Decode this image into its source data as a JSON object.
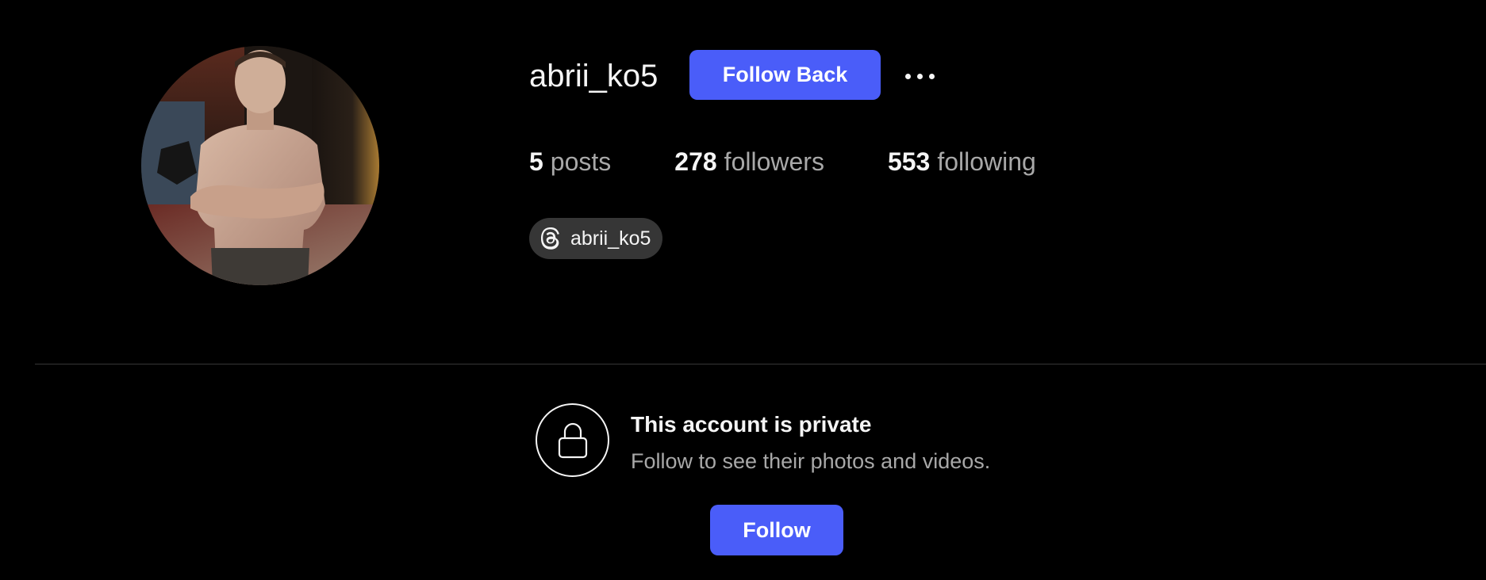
{
  "profile": {
    "username": "abrii_ko5",
    "follow_back_label": "Follow Back",
    "more_icon": "more-horizontal-icon",
    "avatar_alt": "profile-photo"
  },
  "stats": {
    "posts_count": "5",
    "posts_label": "posts",
    "followers_count": "278",
    "followers_label": "followers",
    "following_count": "553",
    "following_label": "following"
  },
  "threads": {
    "icon": "threads-icon",
    "handle": "abrii_ko5"
  },
  "private_notice": {
    "icon": "lock-icon",
    "title": "This account is private",
    "subtitle": "Follow to see their photos and videos.",
    "follow_label": "Follow"
  },
  "colors": {
    "background": "#000000",
    "primary_button": "#4a5df9",
    "text_primary": "#f5f5f5",
    "text_secondary": "#a8a8a8",
    "badge_bg": "#363636",
    "divider": "#363636"
  }
}
